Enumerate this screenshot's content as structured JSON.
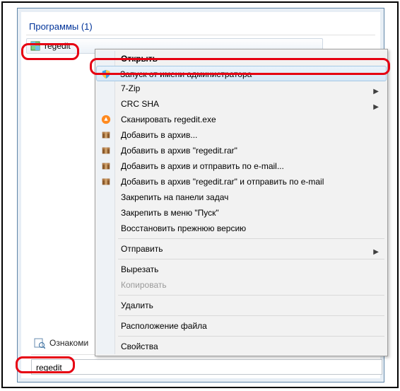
{
  "header": {
    "title": "Программы (1)"
  },
  "program": {
    "name": "regedit"
  },
  "context_menu": {
    "open": "Открыть",
    "run_as_admin": "Запуск от имени администратора",
    "seven_zip": "7-Zip",
    "crc_sha": "CRC SHA",
    "scan": "Сканировать regedit.exe",
    "archive_add": "Добавить в архив...",
    "archive_add_named": "Добавить в архив \"regedit.rar\"",
    "archive_email": "Добавить в архив и отправить по e-mail...",
    "archive_named_email": "Добавить в архив \"regedit.rar\" и отправить по e-mail",
    "pin_taskbar": "Закрепить на панели задач",
    "pin_start": "Закрепить в меню \"Пуск\"",
    "restore_prev": "Восстановить прежнюю версию",
    "send_to": "Отправить",
    "cut": "Вырезать",
    "copy": "Копировать",
    "delete": "Удалить",
    "file_location": "Расположение файла",
    "properties": "Свойства"
  },
  "footer": {
    "see_more": "Ознакоми",
    "search_value": "regedit"
  }
}
